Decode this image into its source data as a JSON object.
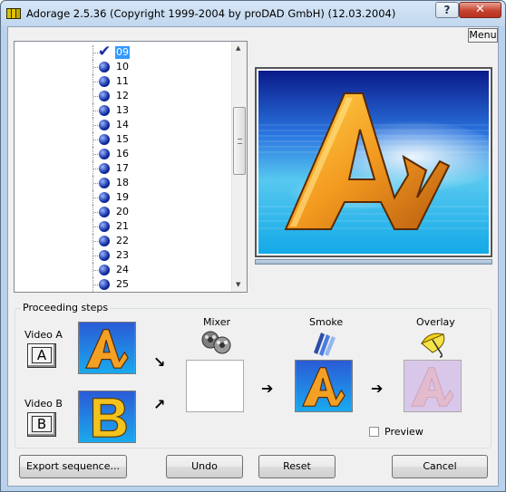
{
  "window": {
    "title": "Adorage 2.5.36  (Copyright 1999-2004 by proDAD GmbH)  (12.03.2004)",
    "help_label": "?",
    "close_label": "✕"
  },
  "menu_label": "Menu",
  "tree": {
    "items": [
      {
        "label": "09",
        "checked": true,
        "selected": true
      },
      {
        "label": "10"
      },
      {
        "label": "11"
      },
      {
        "label": "12"
      },
      {
        "label": "13"
      },
      {
        "label": "14"
      },
      {
        "label": "15"
      },
      {
        "label": "16"
      },
      {
        "label": "17"
      },
      {
        "label": "18"
      },
      {
        "label": "19"
      },
      {
        "label": "20"
      },
      {
        "label": "21"
      },
      {
        "label": "22"
      },
      {
        "label": "23"
      },
      {
        "label": "24"
      },
      {
        "label": "25"
      }
    ]
  },
  "proceeding": {
    "title": "Proceeding steps",
    "video_a_label": "Video A",
    "video_a_key": "A",
    "video_b_label": "Video B",
    "video_b_key": "B",
    "mixer_label": "Mixer",
    "smoke_label": "Smoke",
    "overlay_label": "Overlay",
    "preview_label": "Preview"
  },
  "buttons": {
    "export": "Export sequence...",
    "undo": "Undo",
    "reset": "Reset",
    "cancel": "Cancel"
  },
  "colors": {
    "accent_blue": "#1f55c8",
    "logo_orange": "#f0a020",
    "selection": "#3399ff"
  }
}
